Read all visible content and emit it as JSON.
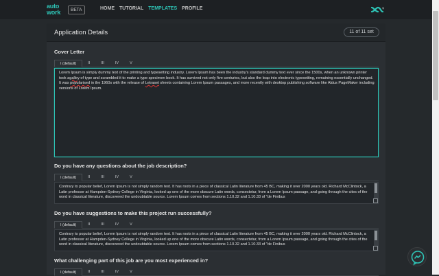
{
  "topbar": {
    "logo_line1": "auto",
    "logo_line2": "work",
    "beta_label": "BETA",
    "nav": [
      {
        "label": "HOME",
        "active": false
      },
      {
        "label": "TUTORIAL",
        "active": false
      },
      {
        "label": "TEMPLATES",
        "active": true
      },
      {
        "label": "PROFILE",
        "active": false
      }
    ],
    "brand_icon": "infinity-icon",
    "brand_caret": "caret-down-icon"
  },
  "card": {
    "title": "Application Details",
    "set_badge": "11 of 11 set"
  },
  "tabs": [
    "I (default)",
    "II",
    "III",
    "IV",
    "V"
  ],
  "questions": [
    {
      "label": "Cover Letter",
      "text_before": "Lorem Ipsum is simply dummy text of the printing and typesetting industry. Lorem Ipsum has been the industry's standard dummy text ever since the 1500s, when an unknown printer took a",
      "text_typo1": "galley",
      "text_middle": " of type and scrambled it to make a type specimen book. It has survived not only five centuries, but also the leap into electronic typesetting, remaining essentially unchanged. It was ",
      "text_typo2": "popularised",
      "text_middle2": " in the 1960s with the release of ",
      "text_typo3": "Letraset",
      "text_after": " sheets containing Lorem Ipsum passages, and more recently with desktop publishing software like Aldus PageMaker including versions of Lorem Ipsum."
    },
    {
      "label": "Do you have any questions about the job description?",
      "text": "Contrary to popular belief, Lorem Ipsum is not simply random text. It has roots in a piece of classical Latin literature from 45 BC, making it over 2000 years old. Richard McClintock, a Latin professor at Hampden-Sydney College in Virginia, looked up one of the more obscure Latin words, consectetur, from a Lorem Ipsum passage, and going through the cites of the word in classical literature, discovered the undoubtable source. Lorem Ipsum comes from sections 1.10.32 and 1.10.33 of \"de Finibus"
    },
    {
      "label": "Do you have suggestions to make this project run successfully?",
      "text": "Contrary to popular belief, Lorem Ipsum is not simply random text. It has roots in a piece of classical Latin literature from 45 BC, making it over 2000 years old. Richard McClintock, a Latin professor at Hampden-Sydney College in Virginia, looked up one of the more obscure Latin words, consectetur, from a Lorem Ipsum passage, and going through the cites of the word in classical literature, discovered the undoubtable source. Lorem Ipsum comes from sections 1.10.32 and 1.10.33 of \"de Finibus"
    },
    {
      "label": "What challenging part of this job are you most experienced in?",
      "text": ""
    }
  ],
  "colors": {
    "accent": "#2ec4b6",
    "background": "#25292c"
  },
  "widget_icon": "messenger-icon"
}
